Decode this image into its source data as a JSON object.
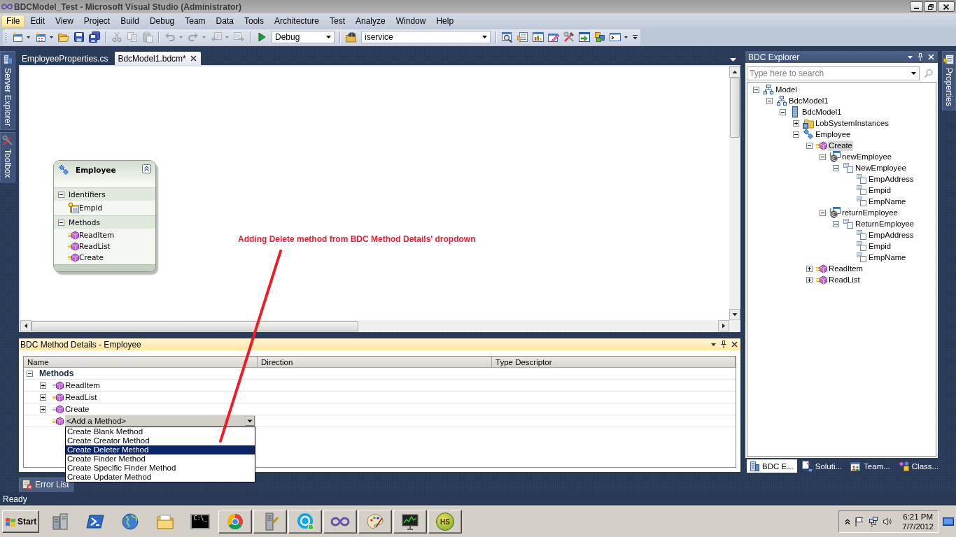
{
  "window": {
    "title": "BDCModel_Test - Microsoft Visual Studio (Administrator)"
  },
  "menu": [
    {
      "label": "File",
      "selected": true
    },
    {
      "label": "Edit",
      "selected": false
    },
    {
      "label": "View",
      "selected": false
    },
    {
      "label": "Project",
      "selected": false
    },
    {
      "label": "Build",
      "selected": false
    },
    {
      "label": "Debug",
      "selected": false
    },
    {
      "label": "Team",
      "selected": false
    },
    {
      "label": "Data",
      "selected": false
    },
    {
      "label": "Tools",
      "selected": false
    },
    {
      "label": "Architecture",
      "selected": false
    },
    {
      "label": "Test",
      "selected": false
    },
    {
      "label": "Analyze",
      "selected": false
    },
    {
      "label": "Window",
      "selected": false
    },
    {
      "label": "Help",
      "selected": false
    }
  ],
  "toolbar": [
    {
      "kind": "new_project",
      "disabled": false,
      "dropdown": true
    },
    {
      "kind": "add_item",
      "disabled": false,
      "dropdown": true
    },
    {
      "kind": "open",
      "disabled": false
    },
    {
      "kind": "save",
      "disabled": false
    },
    {
      "kind": "save_all",
      "disabled": false
    },
    {
      "kind": "separator"
    },
    {
      "kind": "cut",
      "disabled": true
    },
    {
      "kind": "copy",
      "disabled": true
    },
    {
      "kind": "paste",
      "disabled": true
    },
    {
      "kind": "separator"
    },
    {
      "kind": "undo",
      "disabled": true,
      "dropdown": true
    },
    {
      "kind": "redo",
      "disabled": true,
      "dropdown": true
    },
    {
      "kind": "navigate_backward",
      "disabled": true,
      "dropdown": true
    },
    {
      "kind": "navigate_forward",
      "disabled": true
    },
    {
      "kind": "separator"
    },
    {
      "kind": "start",
      "disabled": false
    },
    {
      "kind": "combo",
      "value": "Debug"
    },
    {
      "kind": "separator"
    },
    {
      "kind": "find_in_files",
      "disabled": false
    },
    {
      "kind": "combo",
      "value": "iservice"
    },
    {
      "kind": "separator"
    },
    {
      "kind": "find_symbol",
      "disabled": false
    },
    {
      "kind": "properties_window",
      "disabled": false
    },
    {
      "kind": "object_browser",
      "disabled": false
    },
    {
      "kind": "team_explorer",
      "disabled": false
    },
    {
      "kind": "toolbox",
      "disabled": false
    },
    {
      "kind": "start_page",
      "disabled": false
    },
    {
      "kind": "extension_manager",
      "disabled": false
    },
    {
      "kind": "command_window",
      "disabled": false,
      "dropdown": true
    }
  ],
  "left_tabs": [
    {
      "label": "Server Explorer",
      "kind": "server"
    },
    {
      "label": "Toolbox",
      "kind": "toolbox"
    }
  ],
  "document_tabs": [
    {
      "label": "EmployeeProperties.cs",
      "selected": false
    },
    {
      "label": "BdcModel1.bdcm*",
      "selected": true
    }
  ],
  "designer": {
    "entity": {
      "title": "Employee",
      "expanded": true,
      "sections": [
        {
          "title": "Identifiers",
          "expanded": true,
          "items": [
            {
              "label": "Empid",
              "kind": "identifier"
            }
          ]
        },
        {
          "title": "Methods",
          "expanded": true,
          "items": [
            {
              "label": "ReadItem",
              "kind": "method"
            },
            {
              "label": "ReadList",
              "kind": "method"
            },
            {
              "label": "Create",
              "kind": "method"
            }
          ]
        }
      ]
    },
    "annotation": "Adding Delete method from BDC Method Details' dropdown"
  },
  "method_details": {
    "title": "BDC Method Details - Employee",
    "columns": [
      "Name",
      "Direction",
      "Type Descriptor"
    ],
    "group": {
      "label": "Methods",
      "expanded": true
    },
    "methods": [
      {
        "name": "ReadItem",
        "expanded": false
      },
      {
        "name": "ReadList",
        "expanded": false
      },
      {
        "name": "Create",
        "expanded": false
      }
    ],
    "add_method": {
      "value": "<Add a Method>",
      "open": true,
      "options": [
        {
          "label": "Create Blank Method",
          "selected": false
        },
        {
          "label": "Create Creator Method",
          "selected": false
        },
        {
          "label": "Create Deleter Method",
          "selected": true
        },
        {
          "label": "Create Finder Method",
          "selected": false
        },
        {
          "label": "Create Specific Finder Method",
          "selected": false
        },
        {
          "label": "Create Updater Method",
          "selected": false
        }
      ]
    }
  },
  "bottom_tabs": [
    {
      "label": "Error List"
    }
  ],
  "bdc_explorer": {
    "title": "BDC Explorer",
    "search": {
      "placeholder": "Type here to search"
    },
    "tree": [
      {
        "label": "Model",
        "kind": "model",
        "expanded": true,
        "selected": false,
        "children": [
          {
            "label": "BdcModel1",
            "kind": "model",
            "expanded": true,
            "selected": false,
            "children": [
              {
                "label": "BdcModel1",
                "kind": "lobsystem",
                "expanded": true,
                "selected": false,
                "children": [
                  {
                    "label": "LobSystemInstances",
                    "kind": "folder",
                    "expanded": false,
                    "selected": false
                  },
                  {
                    "label": "Employee",
                    "kind": "entity",
                    "expanded": true,
                    "selected": false,
                    "children": [
                      {
                        "label": "Create",
                        "kind": "method",
                        "expanded": true,
                        "selected": true,
                        "children": [
                          {
                            "label": "newEmployee",
                            "kind": "parameter",
                            "expanded": true,
                            "selected": false,
                            "children": [
                              {
                                "label": "NewEmployee",
                                "kind": "typedesc",
                                "expanded": true,
                                "selected": false,
                                "children": [
                                  {
                                    "label": "EmpAddress",
                                    "kind": "typedesc",
                                    "selected": false
                                  },
                                  {
                                    "label": "Empid",
                                    "kind": "typedesc",
                                    "selected": false
                                  },
                                  {
                                    "label": "EmpName",
                                    "kind": "typedesc",
                                    "selected": false
                                  }
                                ]
                              }
                            ]
                          },
                          {
                            "label": "returnEmployee",
                            "kind": "parameter",
                            "expanded": true,
                            "selected": false,
                            "children": [
                              {
                                "label": "ReturnEmployee",
                                "kind": "typedesc",
                                "expanded": true,
                                "selected": false,
                                "children": [
                                  {
                                    "label": "EmpAddress",
                                    "kind": "typedesc",
                                    "selected": false
                                  },
                                  {
                                    "label": "Empid",
                                    "kind": "typedesc",
                                    "selected": false
                                  },
                                  {
                                    "label": "EmpName",
                                    "kind": "typedesc",
                                    "selected": false
                                  }
                                ]
                              }
                            ]
                          }
                        ]
                      },
                      {
                        "label": "ReadItem",
                        "kind": "method",
                        "expanded": false,
                        "selected": false
                      },
                      {
                        "label": "ReadList",
                        "kind": "method",
                        "expanded": false,
                        "selected": false
                      }
                    ]
                  }
                ]
              }
            ]
          }
        ]
      }
    ],
    "tabs": [
      {
        "label": "BDC E...",
        "kind": "bdc",
        "selected": true
      },
      {
        "label": "Soluti...",
        "kind": "solution",
        "selected": false
      },
      {
        "label": "Team...",
        "kind": "team",
        "selected": false
      },
      {
        "label": "Class...",
        "kind": "class",
        "selected": false
      }
    ]
  },
  "right_tabs": [
    {
      "label": "Properties",
      "kind": "properties"
    }
  ],
  "status_bar": {
    "text": "Ready"
  },
  "taskbar": {
    "start": "Start",
    "apps": [
      {
        "kind": "server",
        "running": false
      },
      {
        "kind": "prompt",
        "running": false
      },
      {
        "kind": "globe",
        "running": false
      },
      {
        "kind": "folder",
        "running": false
      },
      {
        "kind": "console",
        "label": "C:\\_",
        "running": false
      },
      {
        "kind": "browser",
        "running": true
      },
      {
        "kind": "tower",
        "running": true
      },
      {
        "kind": "bubble",
        "running": true
      },
      {
        "kind": "infinity",
        "running": true
      },
      {
        "kind": "palette",
        "running": true
      },
      {
        "kind": "monitor",
        "running": true
      },
      {
        "kind": "badge",
        "label": "HS",
        "running": true
      }
    ],
    "time": "6:21 PM",
    "date": "7/7/2012"
  }
}
